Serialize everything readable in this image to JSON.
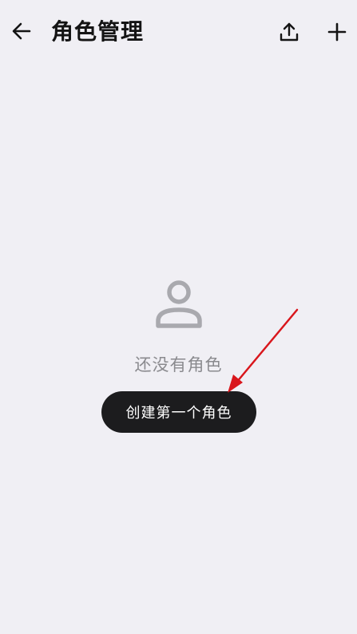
{
  "header": {
    "title": "角色管理",
    "back_icon": "arrow-left-icon",
    "export_icon": "upload-icon",
    "add_icon": "plus-icon"
  },
  "empty_state": {
    "icon": "person-icon",
    "message": "还没有角色",
    "create_button_label": "创建第一个角色"
  },
  "colors": {
    "background": "#f0eff4",
    "button_bg": "#1c1c1e",
    "annotation_arrow": "#d9161c"
  }
}
